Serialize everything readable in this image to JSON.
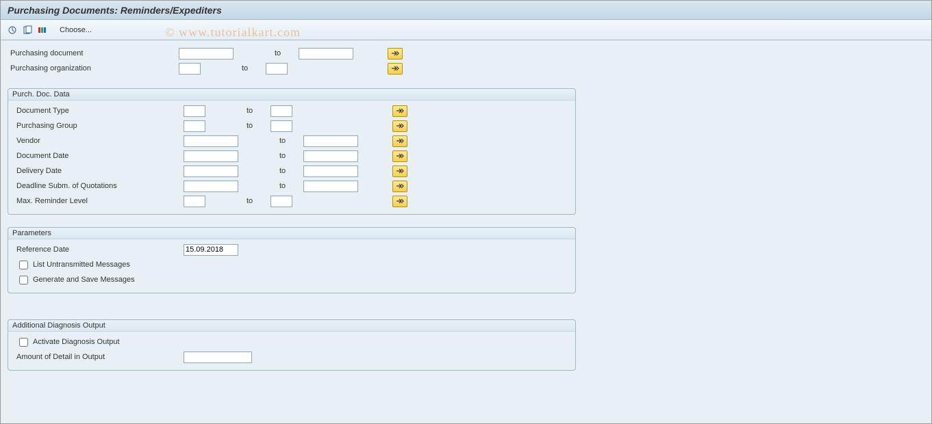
{
  "title": "Purchasing Documents: Reminders/Expediters",
  "toolbar": {
    "choose_label": "Choose..."
  },
  "watermark": "© www.tutorialkart.com",
  "top_selection": [
    {
      "label": "Purchasing document",
      "from": "",
      "to_label": "to",
      "to": "",
      "from_w": "md",
      "to_w": "md",
      "multi": true
    },
    {
      "label": "Purchasing organization",
      "from": "",
      "to_label": "to",
      "to": "",
      "from_w": "sm",
      "to_w": "sm",
      "multi": true
    }
  ],
  "groups": {
    "purchDoc": {
      "title": "Purch. Doc. Data",
      "rows": [
        {
          "label": "Document Type",
          "from": "",
          "to_label": "to",
          "to": "",
          "from_w": "sm",
          "to_w": "sm",
          "multi": true
        },
        {
          "label": "Purchasing Group",
          "from": "",
          "to_label": "to",
          "to": "",
          "from_w": "sm",
          "to_w": "sm",
          "multi": true
        },
        {
          "label": "Vendor",
          "from": "",
          "to_label": "to",
          "to": "",
          "from_w": "md",
          "to_w": "md",
          "multi": true
        },
        {
          "label": "Document Date",
          "from": "",
          "to_label": "to",
          "to": "",
          "from_w": "md",
          "to_w": "md",
          "multi": true
        },
        {
          "label": "Delivery Date",
          "from": "",
          "to_label": "to",
          "to": "",
          "from_w": "md",
          "to_w": "md",
          "multi": true
        },
        {
          "label": "Deadline Subm. of Quotations",
          "from": "",
          "to_label": "to",
          "to": "",
          "from_w": "md",
          "to_w": "md",
          "multi": true
        },
        {
          "label": "Max. Reminder Level",
          "from": "",
          "to_label": "to",
          "to": "",
          "from_w": "sm",
          "to_w": "sm",
          "multi": true
        }
      ]
    },
    "parameters": {
      "title": "Parameters",
      "reference_date_label": "Reference Date",
      "reference_date_value": "15.09.2018",
      "checkbox1": "List Untransmitted Messages",
      "checkbox2": "Generate and Save Messages"
    },
    "diagnosis": {
      "title": "Additional Diagnosis Output",
      "checkbox1": "Activate Diagnosis Output",
      "detail_label": "Amount of Detail in Output",
      "detail_value": ""
    }
  }
}
